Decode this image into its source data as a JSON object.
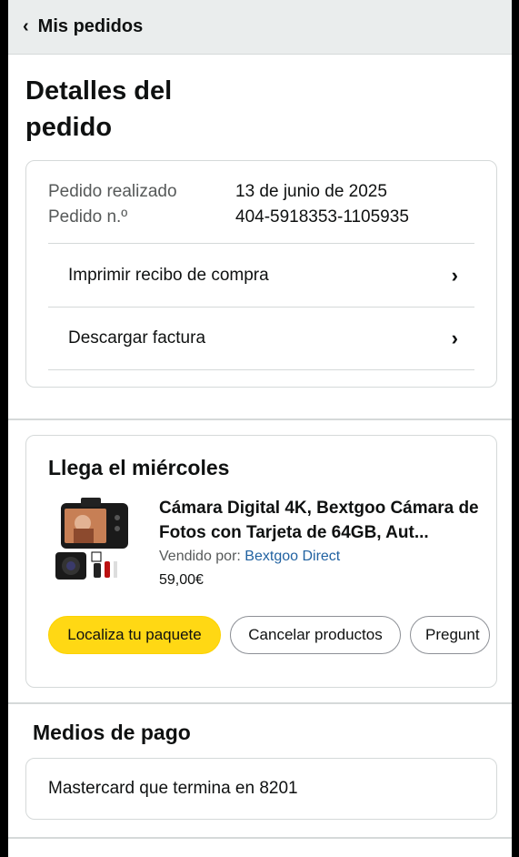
{
  "header": {
    "back_label": "Mis pedidos"
  },
  "page_title": "Detalles del pedido",
  "summary": {
    "order_date_label": "Pedido realizado",
    "order_date_value": "13 de junio de 2025",
    "order_number_label": "Pedido n.º",
    "order_number_value": "404-5918353-1105935",
    "links": [
      {
        "label": "Imprimir recibo de compra"
      },
      {
        "label": "Descargar factura"
      }
    ]
  },
  "delivery": {
    "title": "Llega el miércoles",
    "product": {
      "title": "Cámara Digital 4K, Bextgoo Cámara de Fotos con Tarjeta de 64GB, Aut...",
      "sold_by_label": "Vendido por: ",
      "seller": "Bextgoo Direct",
      "price": "59,00€"
    },
    "buttons": {
      "track": "Localiza tu paquete",
      "cancel": "Cancelar productos",
      "ask": "Pregunt"
    }
  },
  "payment": {
    "title": "Medios de pago",
    "method": "Mastercard que termina en 8201"
  },
  "colors": {
    "primary_button": "#ffd814",
    "link": "#2162a1",
    "header_bg": "#eaeded"
  }
}
